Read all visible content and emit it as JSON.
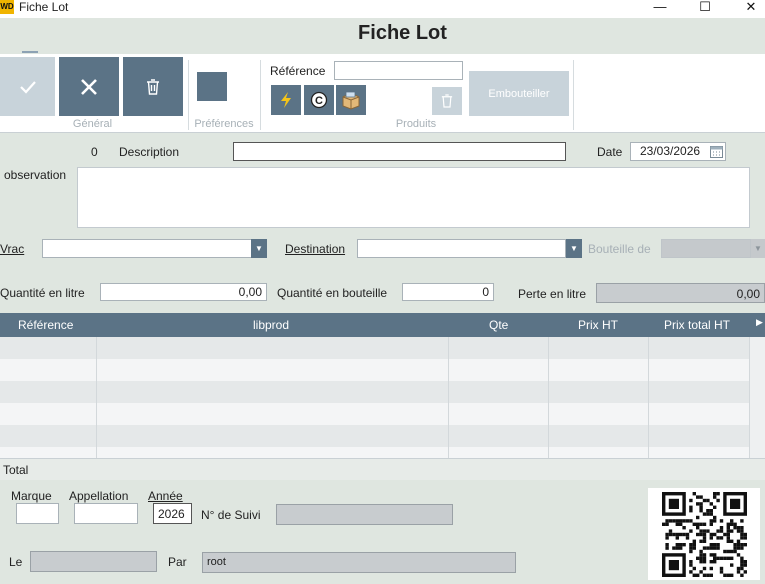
{
  "window": {
    "app_logo": "WD",
    "title": "Fiche Lot",
    "minimize": "—",
    "maximize": "☐",
    "close": "✕"
  },
  "header": {
    "title": "Fiche Lot"
  },
  "ribbon": {
    "groups": [
      "Général",
      "Préférences",
      "Produits"
    ],
    "validate_icon": "check-icon",
    "cancel_icon": "close-icon",
    "delete_icon": "trash-icon",
    "reference_label": "Référence",
    "reference_value": "",
    "bottle_button": "Embouteiller"
  },
  "form": {
    "counter": "0",
    "description_label": "Description",
    "description_value": "",
    "date_label": "Date",
    "date_value": "23/03/2026",
    "observation_label": "observation",
    "vrac_label": "Vrac",
    "destination_label": "Destination",
    "bouteille_label": "Bouteille de",
    "qte_litre_label": "Quantité en litre",
    "qte_litre_value": "0,00",
    "qte_bouteille_label": "Quantité en bouteille",
    "qte_bouteille_value": "0",
    "perte_label": "Perte en litre",
    "perte_value": "0,00"
  },
  "table": {
    "columns": [
      "Référence",
      "libprod",
      "Qte",
      "Prix HT",
      "Prix total HT"
    ],
    "rows": [],
    "total_label": "Total"
  },
  "bottom": {
    "marque_label": "Marque",
    "marque_value": "",
    "appellation_label": "Appellation",
    "appellation_value": "",
    "annee_label": "Année",
    "annee_value": "2026",
    "suivi_label": "N° de Suivi",
    "suivi_value": "",
    "le_label": "Le",
    "le_value": "",
    "par_label": "Par",
    "par_value": "root"
  },
  "colors": {
    "accent": "#5b7386",
    "background": "#dfe6e0",
    "disabled": "#c8d3da"
  }
}
